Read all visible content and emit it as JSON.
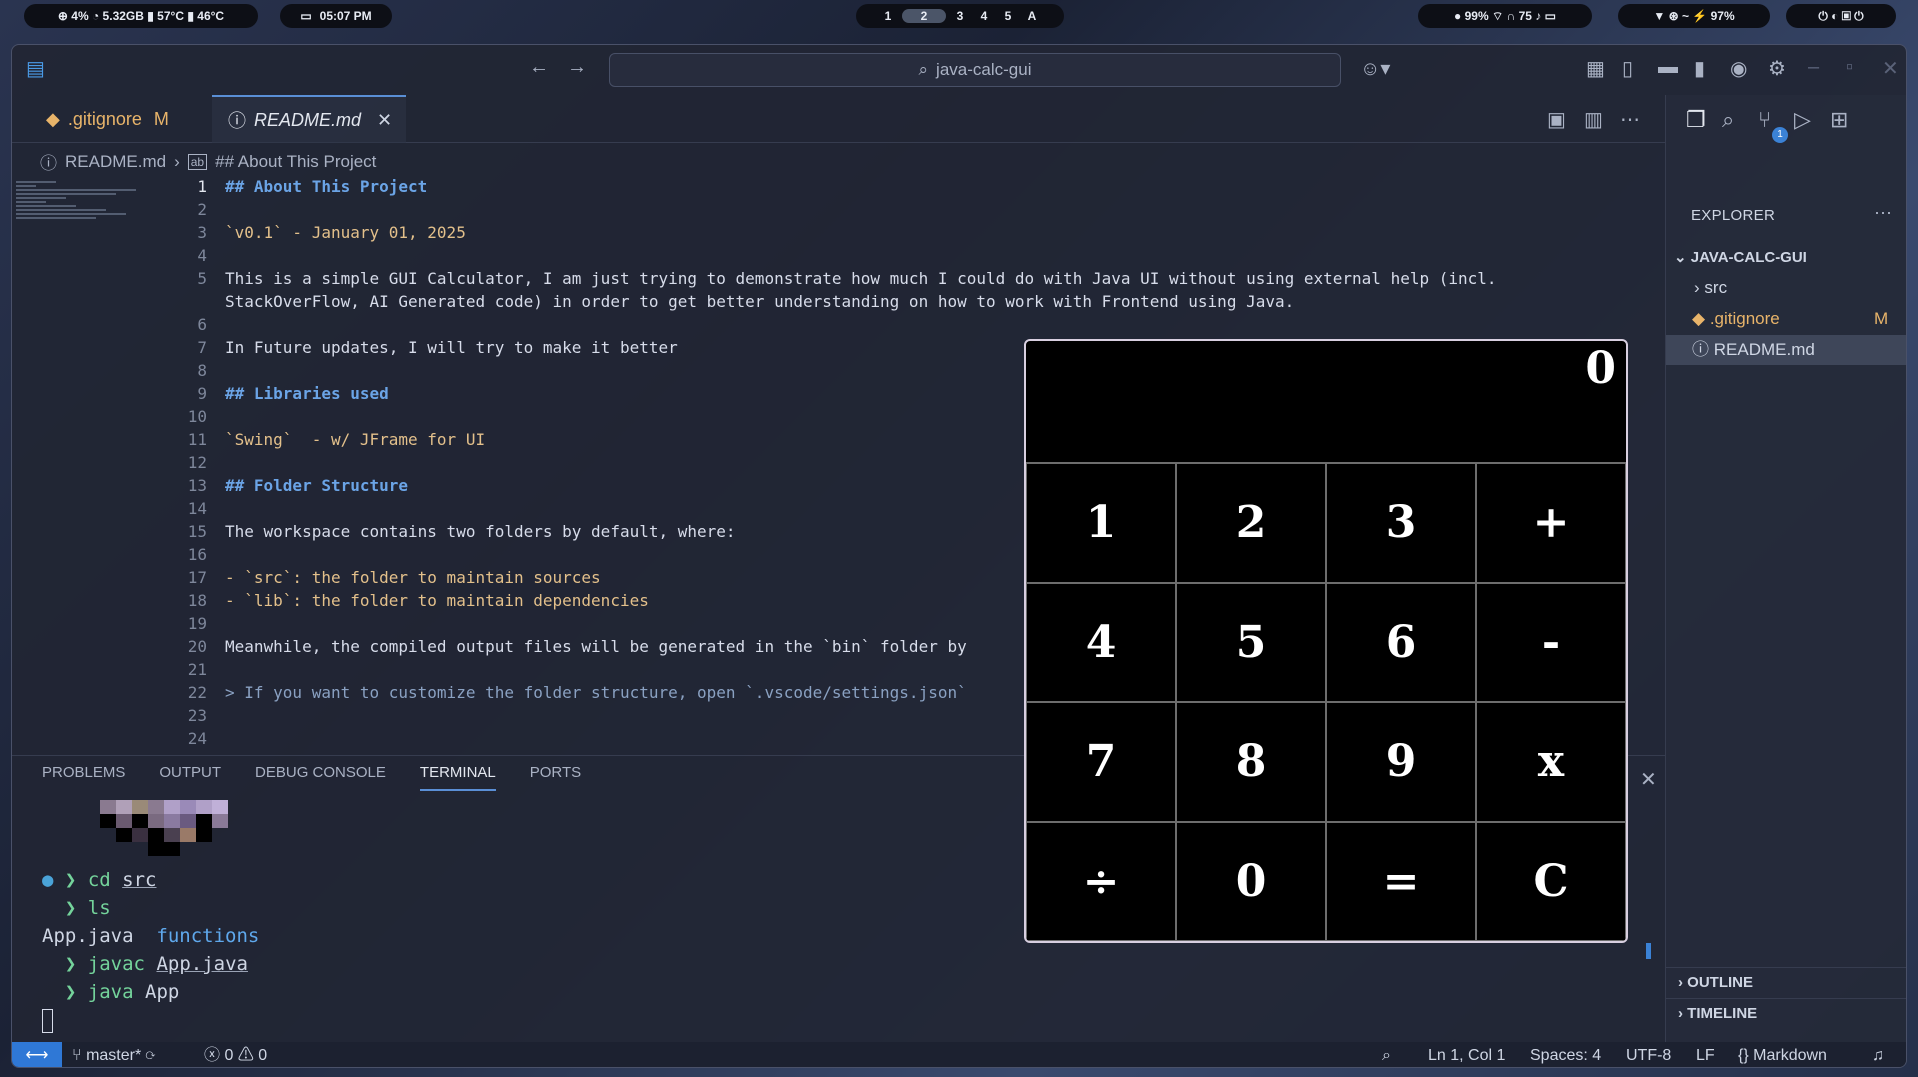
{
  "topbar": {
    "stats": "⊕ 4%  ◔ 5.32GB  ▮ 57°C  ▮ 46°C",
    "clock": "05:07 PM",
    "workspaces": [
      "1",
      "2",
      "3",
      "4",
      "5",
      "A"
    ],
    "sys": "● 99%  ⌔  ∩ 75  ♪  ▭",
    "net": "▼  ⊛  ~  ⚡ 97%",
    "power": "⏻ ◐ ▣ ⏻"
  },
  "title": {
    "search": "java-calc-gui"
  },
  "tabs": [
    {
      "label": ".gitignore",
      "mod": "M"
    },
    {
      "label": "README.md"
    }
  ],
  "breadcrumb": {
    "file": "README.md",
    "section": "## About This Project"
  },
  "editor": {
    "lines": [
      {
        "n": "1",
        "t": "## About This Project"
      },
      {
        "n": "2",
        "t": ""
      },
      {
        "n": "3",
        "t": "`v0.1` - January 01, 2025"
      },
      {
        "n": "4",
        "t": ""
      },
      {
        "n": "5",
        "t": "This is a simple GUI Calculator, I am just trying to demonstrate how much I could do with Java UI without using external help (incl."
      },
      {
        "n": "",
        "t": "StackOverFlow, AI Generated code) in order to get better understanding on how to work with Frontend using Java."
      },
      {
        "n": "6",
        "t": ""
      },
      {
        "n": "7",
        "t": "In Future updates, I will try to make it better"
      },
      {
        "n": "8",
        "t": ""
      },
      {
        "n": "9",
        "t": "## Libraries used"
      },
      {
        "n": "10",
        "t": ""
      },
      {
        "n": "11",
        "t": "`Swing`  - w/ JFrame for UI"
      },
      {
        "n": "12",
        "t": ""
      },
      {
        "n": "13",
        "t": "## Folder Structure"
      },
      {
        "n": "14",
        "t": ""
      },
      {
        "n": "15",
        "t": "The workspace contains two folders by default, where:"
      },
      {
        "n": "16",
        "t": ""
      },
      {
        "n": "17",
        "t": "- `src`: the folder to maintain sources"
      },
      {
        "n": "18",
        "t": "- `lib`: the folder to maintain dependencies"
      },
      {
        "n": "19",
        "t": ""
      },
      {
        "n": "20",
        "t": "Meanwhile, the compiled output files will be generated in the `bin` folder by"
      },
      {
        "n": "21",
        "t": ""
      },
      {
        "n": "22",
        "t": "> If you want to customize the folder structure, open `.vscode/settings.json`"
      },
      {
        "n": "23",
        "t": ""
      },
      {
        "n": "24",
        "t": ""
      }
    ]
  },
  "panel": {
    "tabs": [
      "PROBLEMS",
      "OUTPUT",
      "DEBUG CONSOLE",
      "TERMINAL",
      "PORTS"
    ],
    "active": "TERMINAL",
    "terminal": {
      "l1_cmd": "cd",
      "l1_arg": "src",
      "l2_cmd": "ls",
      "l3_a": "App.java",
      "l3_b": "functions",
      "l4_cmd": "javac",
      "l4_arg": "App.java",
      "l5_cmd": "java",
      "l5_arg": "App"
    }
  },
  "sidebar": {
    "explorer": "EXPLORER",
    "project": "JAVA-CALC-GUI",
    "items": [
      {
        "label": "src"
      },
      {
        "label": ".gitignore",
        "mod": "M"
      },
      {
        "label": "README.md"
      }
    ],
    "outline": "OUTLINE",
    "timeline": "TIMELINE",
    "scm_badge": "1"
  },
  "status": {
    "branch": "master*",
    "errors": "0",
    "warnings": "0",
    "position": "Ln 1, Col 1",
    "spaces": "Spaces: 4",
    "encoding": "UTF-8",
    "eol": "LF",
    "language": "Markdown"
  },
  "calculator": {
    "display": "0",
    "keys": [
      "1",
      "2",
      "3",
      "+",
      "4",
      "5",
      "6",
      "-",
      "7",
      "8",
      "9",
      "x",
      "÷",
      "0",
      "=",
      "C"
    ]
  },
  "colors": {
    "accent": "#2f78d6",
    "heading": "#6ba4e6",
    "modified": "#e8b46a"
  }
}
